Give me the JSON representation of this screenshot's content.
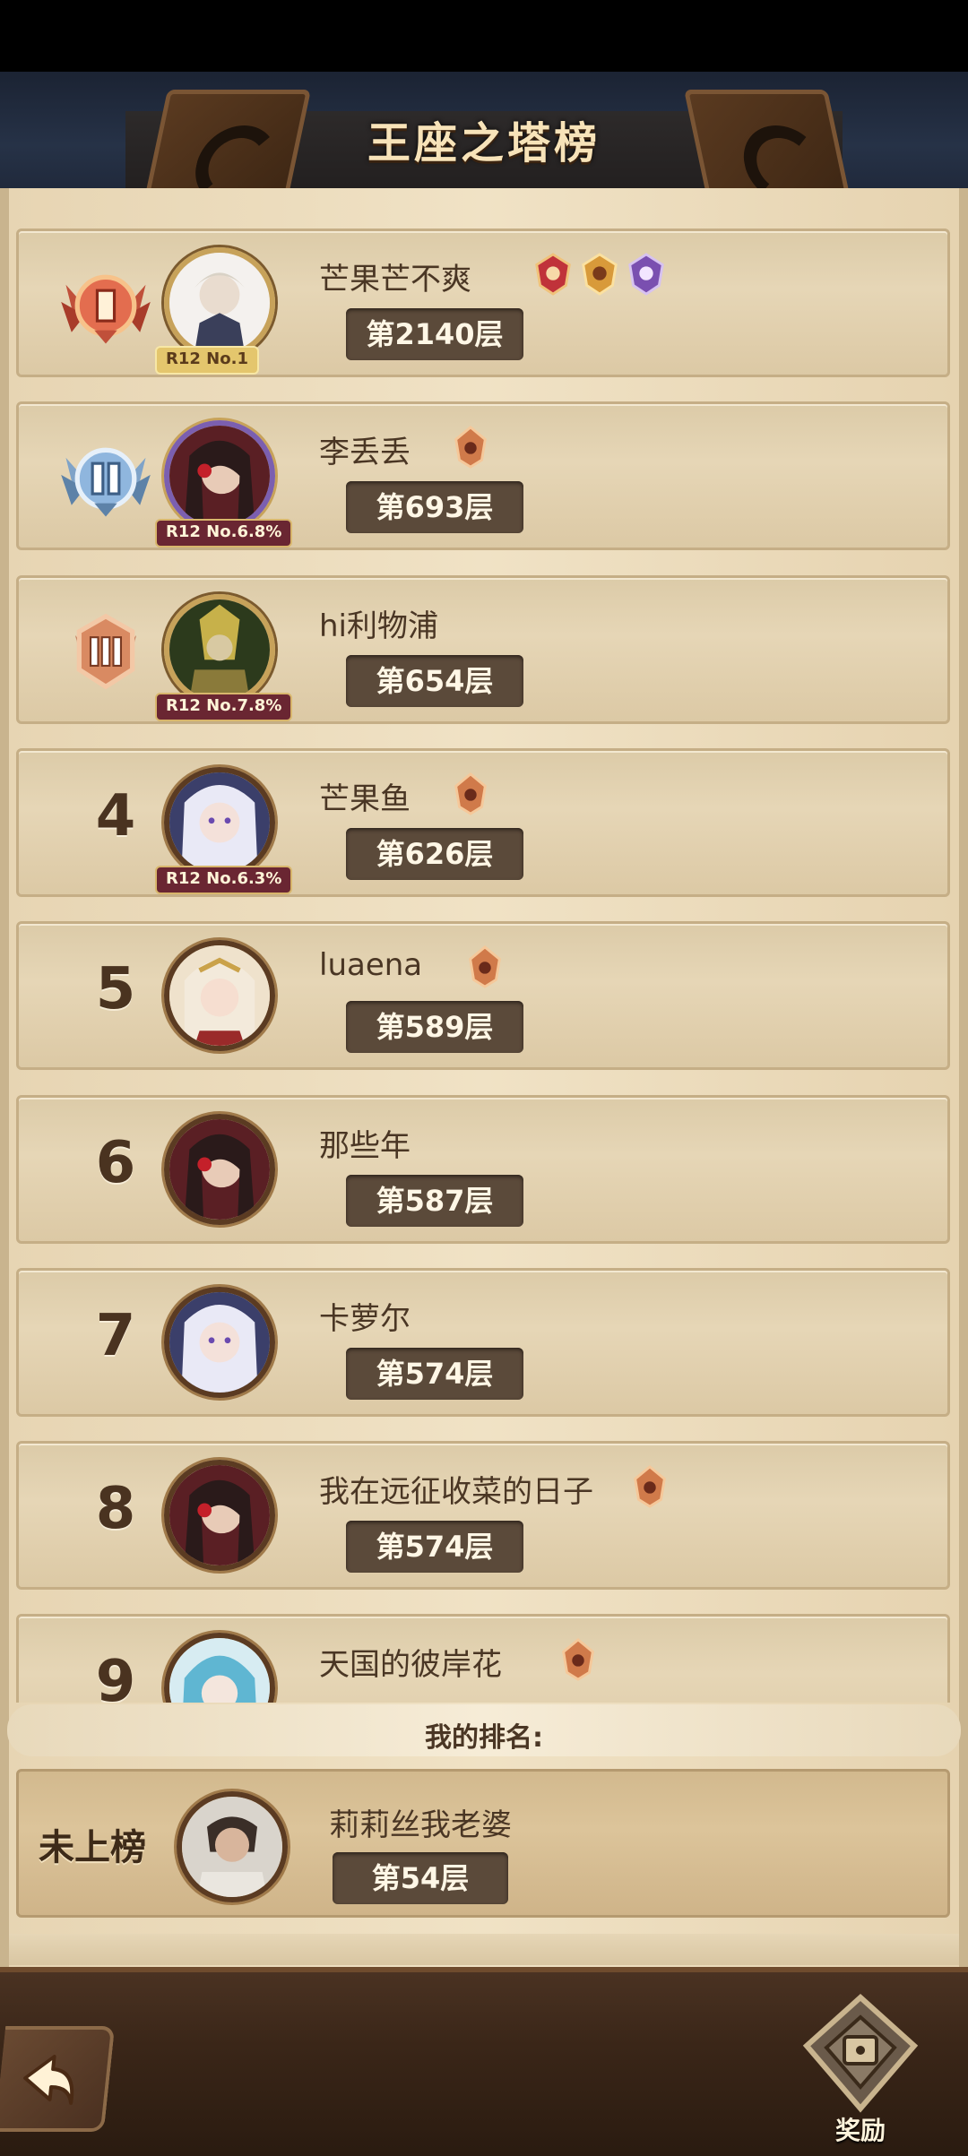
{
  "title": "王座之塔榜",
  "entries": [
    {
      "rank": "1",
      "name": "芒果芒不爽",
      "floor": "第2140层",
      "tag": "R12 No.1",
      "badges": [
        "red-crest-icon",
        "gold-crest-icon",
        "purple-crest-icon"
      ]
    },
    {
      "rank": "2",
      "name": "李丢丢",
      "floor": "第693层",
      "tag": "R12 No.6.8%",
      "badges": [
        "bronze-crest-icon"
      ]
    },
    {
      "rank": "3",
      "name": "hi利物浦",
      "floor": "第654层",
      "tag": "R12 No.7.8%",
      "badges": []
    },
    {
      "rank": "4",
      "name": "芒果鱼",
      "floor": "第626层",
      "tag": "R12 No.6.3%",
      "badges": [
        "bronze-crest-icon"
      ]
    },
    {
      "rank": "5",
      "name": "luaena",
      "floor": "第589层",
      "tag": "",
      "badges": [
        "bronze-crest-icon"
      ]
    },
    {
      "rank": "6",
      "name": "那些年",
      "floor": "第587层",
      "tag": "",
      "badges": []
    },
    {
      "rank": "7",
      "name": "卡萝尔",
      "floor": "第574层",
      "tag": "",
      "badges": []
    },
    {
      "rank": "8",
      "name": "我在远征收菜的日子",
      "floor": "第574层",
      "tag": "",
      "badges": [
        "bronze-crest-icon"
      ]
    },
    {
      "rank": "9",
      "name": "天国的彼岸花",
      "floor": "",
      "tag": "",
      "badges": [
        "bronze-crest-icon"
      ]
    }
  ],
  "my_ranking": {
    "label": "我的排名:",
    "rank": "未上榜",
    "name": "莉莉丝我老婆",
    "floor": "第54层"
  },
  "footer": {
    "back_icon": "back-arrow-icon",
    "reward_label": "奖励"
  },
  "colors": {
    "panel": "#efe1c3",
    "row": "#e2d2b0",
    "floor_pill": "#5b4a3a",
    "text_dark": "#4a3624",
    "header_text": "#f7e3b9"
  }
}
